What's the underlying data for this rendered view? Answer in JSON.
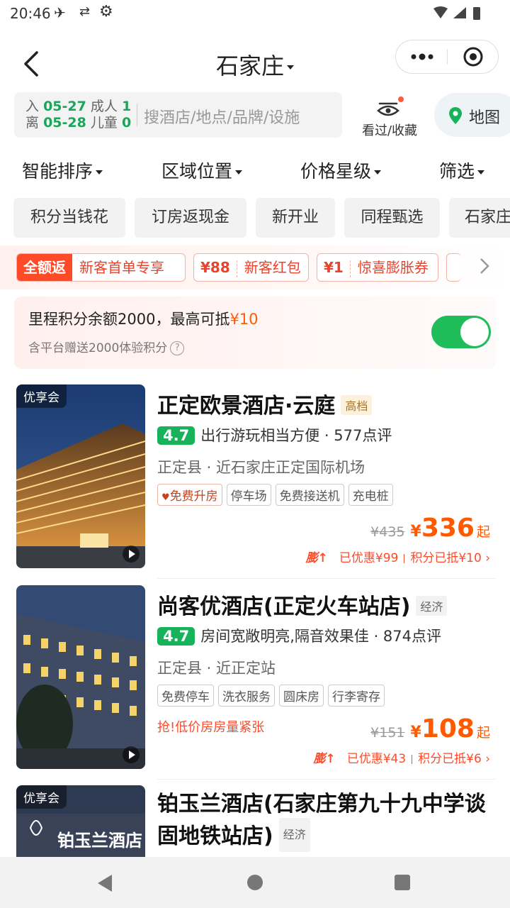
{
  "status": {
    "time": "20:46"
  },
  "nav": {
    "city": "石家庄"
  },
  "search": {
    "checkin_label": "入",
    "checkin": "05-27",
    "checkout_label": "离",
    "checkout": "05-28",
    "adults_label": "成人",
    "adults": "1",
    "children_label": "儿童",
    "children": "0",
    "placeholder": "搜酒店/地点/品牌/设施",
    "favorites_label": "看过/收藏",
    "map_label": "地图"
  },
  "sort": [
    "智能排序",
    "区域位置",
    "价格星级",
    "筛选"
  ],
  "chips": [
    "积分当钱花",
    "订房返现金",
    "新开业",
    "同程甄选",
    "石家庄"
  ],
  "promos": [
    {
      "lead": "全额返",
      "text": "新客首单专享"
    },
    {
      "lead": "¥88",
      "text": "新客红包"
    },
    {
      "lead": "¥1",
      "text": "惊喜膨胀券"
    }
  ],
  "points": {
    "line1_prefix": "里程积分余额2000，最高可抵",
    "line1_amount": "¥10",
    "line2": "含平台赠送2000体验积分",
    "enabled": true
  },
  "hotels": [
    {
      "club": "优享会",
      "name": "正定欧景酒店·云庭",
      "grade": "高档",
      "score": "4.7",
      "highlight": "出行游玩相当方便",
      "reviews": "· 577点评",
      "location": "正定县 · 近石家庄正定国际机场",
      "tags": [
        "免费升房",
        "停车场",
        "免费接送机",
        "充电桩"
      ],
      "old_price": "¥435",
      "currency": "¥",
      "price": "336",
      "price_suffix": "起",
      "boom": "膨↑",
      "saved": "已优惠¥99",
      "points_used": "积分已抵¥10"
    },
    {
      "club": "",
      "name": "尚客优酒店(正定火车站店)",
      "grade": "经济",
      "score": "4.7",
      "highlight": "房间宽敞明亮,隔音效果佳",
      "reviews": "· 874点评",
      "location": "正定县 · 近正定站",
      "tags": [
        "免费停车",
        "洗衣服务",
        "圆床房",
        "行李寄存"
      ],
      "urgent": "抢!低价房房量紧张",
      "old_price": "¥151",
      "currency": "¥",
      "price": "108",
      "price_suffix": "起",
      "boom": "膨↑",
      "saved": "已优惠¥43",
      "points_used": "积分已抵¥6"
    },
    {
      "club": "优享会",
      "name_line1": "铂玉兰酒店(石家庄第九十九中学谈",
      "name_line2": "固地铁站店)",
      "grade": "经济",
      "image_sign": "铂玉兰酒店"
    }
  ],
  "colors": {
    "accent": "#ff5a00",
    "green": "#16b35b",
    "promo_red": "#e8432d"
  }
}
